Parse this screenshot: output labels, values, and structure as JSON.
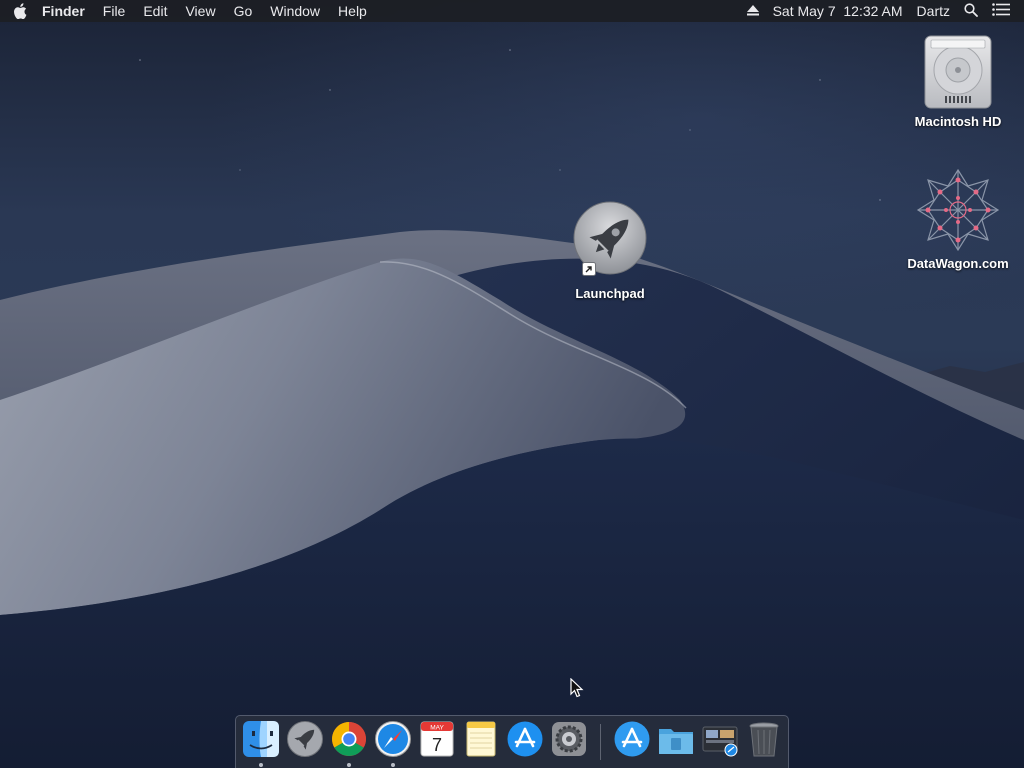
{
  "menubar": {
    "apple_icon": "apple-logo-icon",
    "app_name": "Finder",
    "menus": [
      "File",
      "Edit",
      "View",
      "Go",
      "Window",
      "Help"
    ],
    "eject_icon": "eject-icon",
    "clock": "Sat May 7  12:32 AM",
    "user": "Dartz",
    "search_icon": "spotlight-search-icon",
    "notification_icon": "notification-center-icon"
  },
  "desktop": {
    "icons": [
      {
        "label": "Macintosh HD",
        "icon": "hard-drive-icon"
      },
      {
        "label": "DataWagon.com",
        "icon": "network-volume-icon"
      },
      {
        "label": "Launchpad",
        "icon": "launchpad-rocket-icon"
      }
    ]
  },
  "dock": {
    "calendar": {
      "month": "MAY",
      "day": "7"
    },
    "items": [
      {
        "name": "Finder",
        "icon": "finder-icon",
        "running": true
      },
      {
        "name": "Launchpad",
        "icon": "launchpad-icon",
        "running": false
      },
      {
        "name": "Google Chrome",
        "icon": "chrome-icon",
        "running": true
      },
      {
        "name": "Safari",
        "icon": "safari-icon",
        "running": true
      },
      {
        "name": "Calendar",
        "icon": "calendar-icon",
        "running": false
      },
      {
        "name": "Notes",
        "icon": "notes-icon",
        "running": false
      },
      {
        "name": "App Store",
        "icon": "app-store-icon",
        "running": false
      },
      {
        "name": "System Preferences",
        "icon": "system-preferences-icon",
        "running": false
      },
      {
        "name": "Applications",
        "icon": "applications-folder-icon",
        "running": false
      },
      {
        "name": "Documents",
        "icon": "documents-folder-icon",
        "running": false
      },
      {
        "name": "Downloads",
        "icon": "downloads-stack-icon",
        "running": false
      },
      {
        "name": "Trash",
        "icon": "trash-icon",
        "running": false
      }
    ]
  },
  "colors": {
    "menubar_bg": "#1c1e24",
    "sky_top": "#1b2336",
    "sky_mid": "#2b3a56",
    "dune_light": "#8a90a0",
    "dune_dark": "#1b2740"
  }
}
